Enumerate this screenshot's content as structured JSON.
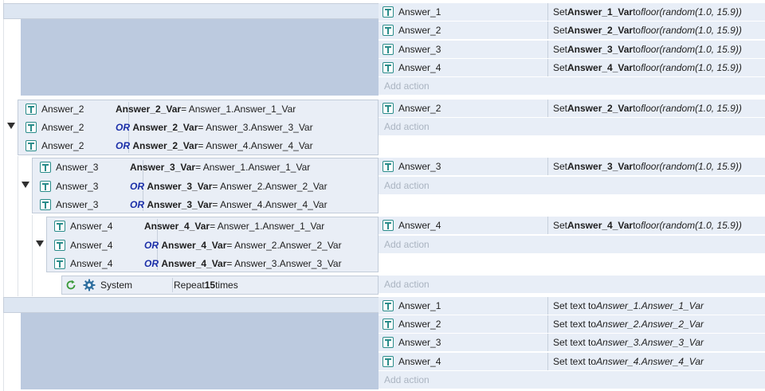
{
  "events": [
    {
      "actions": [
        {
          "object": "Answer_1",
          "prefix": "Set ",
          "var": "Answer_1_Var",
          "mid": " to ",
          "expr": "floor(random(1.0, 15.9))"
        },
        {
          "object": "Answer_2",
          "prefix": "Set ",
          "var": "Answer_2_Var",
          "mid": " to ",
          "expr": "floor(random(1.0, 15.9))"
        },
        {
          "object": "Answer_3",
          "prefix": "Set ",
          "var": "Answer_3_Var",
          "mid": " to ",
          "expr": "floor(random(1.0, 15.9))"
        },
        {
          "object": "Answer_4",
          "prefix": "Set ",
          "var": "Answer_4_Var",
          "mid": " to ",
          "expr": "floor(random(1.0, 15.9))"
        }
      ],
      "add_action": "Add action"
    },
    {
      "conditions": [
        {
          "object": "Answer_2",
          "or": "",
          "var": "Answer_2_Var",
          "rest": " = Answer_1.Answer_1_Var"
        },
        {
          "object": "Answer_2",
          "or": "OR",
          "var": "Answer_2_Var",
          "rest": " = Answer_3.Answer_3_Var"
        },
        {
          "object": "Answer_2",
          "or": "OR",
          "var": "Answer_2_Var",
          "rest": " = Answer_4.Answer_4_Var"
        }
      ],
      "actions": [
        {
          "object": "Answer_2",
          "prefix": "Set ",
          "var": "Answer_2_Var",
          "mid": " to ",
          "expr": "floor(random(1.0, 15.9))"
        }
      ],
      "add_action": "Add action"
    },
    {
      "conditions": [
        {
          "object": "Answer_3",
          "or": "",
          "var": "Answer_3_Var",
          "rest": " = Answer_1.Answer_1_Var"
        },
        {
          "object": "Answer_3",
          "or": "OR",
          "var": "Answer_3_Var",
          "rest": " = Answer_2.Answer_2_Var"
        },
        {
          "object": "Answer_3",
          "or": "OR",
          "var": "Answer_3_Var",
          "rest": " = Answer_4.Answer_4_Var"
        }
      ],
      "actions": [
        {
          "object": "Answer_3",
          "prefix": "Set ",
          "var": "Answer_3_Var",
          "mid": " to ",
          "expr": "floor(random(1.0, 15.9))"
        }
      ],
      "add_action": "Add action"
    },
    {
      "conditions": [
        {
          "object": "Answer_4",
          "or": "",
          "var": "Answer_4_Var",
          "rest": " = Answer_1.Answer_1_Var"
        },
        {
          "object": "Answer_4",
          "or": "OR",
          "var": "Answer_4_Var",
          "rest": " = Answer_2.Answer_2_Var"
        },
        {
          "object": "Answer_4",
          "or": "OR",
          "var": "Answer_4_Var",
          "rest": " = Answer_3.Answer_3_Var"
        }
      ],
      "actions": [
        {
          "object": "Answer_4",
          "prefix": "Set ",
          "var": "Answer_4_Var",
          "mid": " to ",
          "expr": "floor(random(1.0, 15.9))"
        }
      ],
      "add_action": "Add action"
    },
    {
      "condition": {
        "object": "System",
        "pre": "Repeat ",
        "count": "15",
        "post": " times"
      },
      "add_action": "Add action"
    },
    {
      "actions": [
        {
          "object": "Answer_1",
          "prefix": "Set text to ",
          "expr": "Answer_1.Answer_1_Var"
        },
        {
          "object": "Answer_2",
          "prefix": "Set text to ",
          "expr": "Answer_2.Answer_2_Var"
        },
        {
          "object": "Answer_3",
          "prefix": "Set text to ",
          "expr": "Answer_3.Answer_3_Var"
        },
        {
          "object": "Answer_4",
          "prefix": "Set text to ",
          "expr": "Answer_4.Answer_4_Var"
        }
      ],
      "add_action": "Add action"
    }
  ]
}
